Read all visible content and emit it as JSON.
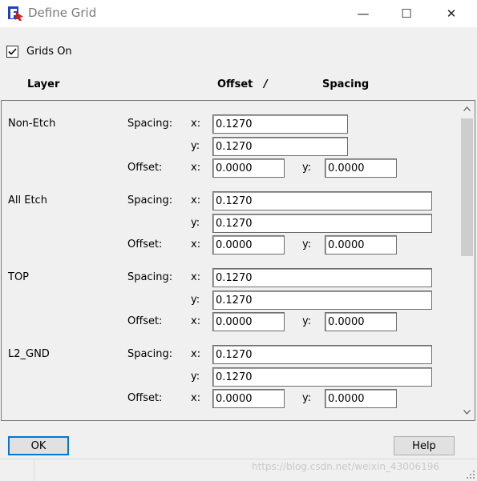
{
  "window": {
    "title": "Define Grid",
    "minimize_glyph": "—",
    "maximize_glyph": "☐",
    "close_glyph": "✕"
  },
  "grids_on": {
    "label": "Grids On",
    "checked": true
  },
  "headers": {
    "layer": "Layer",
    "offset": "Offset",
    "slash": "/",
    "spacing": "Spacing"
  },
  "labels": {
    "spacing": "Spacing:",
    "offset": "Offset:",
    "x": "x:",
    "y": "y:"
  },
  "layers": [
    {
      "name": "Non-Etch",
      "spacing_x": "0.1270",
      "spacing_y": "0.1270",
      "offset_x": "0.0000",
      "offset_y": "0.0000"
    },
    {
      "name": "All Etch",
      "spacing_x": "0.1270",
      "spacing_y": "0.1270",
      "offset_x": "0.0000",
      "offset_y": "0.0000"
    },
    {
      "name": "TOP",
      "spacing_x": "0.1270",
      "spacing_y": "0.1270",
      "offset_x": "0.0000",
      "offset_y": "0.0000"
    },
    {
      "name": "L2_GND",
      "spacing_x": "0.1270",
      "spacing_y": "0.1270",
      "offset_x": "0.0000",
      "offset_y": "0.0000"
    }
  ],
  "buttons": {
    "ok": "OK",
    "help": "Help"
  },
  "watermark": "https://blog.csdn.net/weixin_43006196",
  "icons": {
    "app": "app-logo-icon",
    "check": "checkmark-icon",
    "scroll_up": "scroll-up-arrow-icon",
    "scroll_down": "scroll-down-arrow-icon"
  },
  "colors": {
    "accent": "#0078d7",
    "background": "#f0f0f0",
    "title_text": "#7a7a7a"
  }
}
